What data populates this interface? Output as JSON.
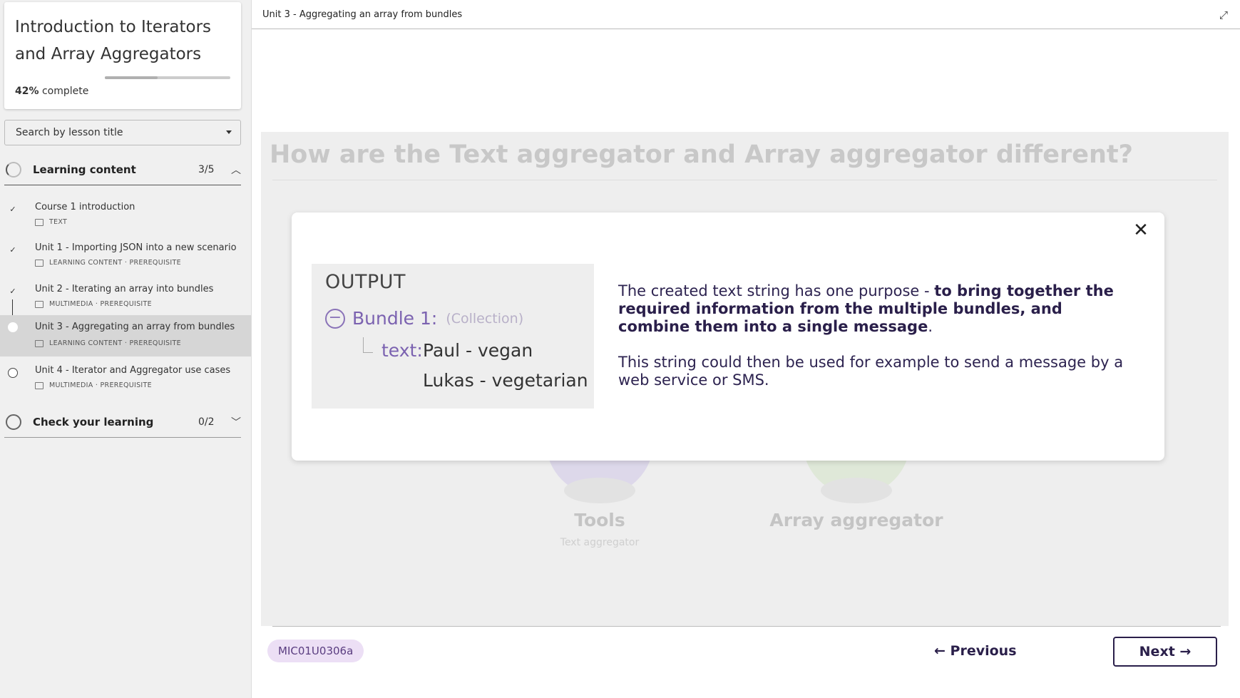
{
  "sidebar": {
    "course_title": "Introduction to Iterators and Array Aggregators",
    "progress": {
      "percent_label": "42%",
      "suffix": " complete",
      "value": 0.42
    },
    "search": {
      "placeholder": "Search by lesson title"
    },
    "sections": [
      {
        "label": "Learning content",
        "count": "3/5",
        "expanded": true
      },
      {
        "label": "Check your learning",
        "count": "0/2",
        "expanded": false
      }
    ],
    "lessons": [
      {
        "title": "Course 1 introduction",
        "meta": "TEXT",
        "status": "done"
      },
      {
        "title": "Unit 1 - Importing JSON into a new scenario",
        "meta": "LEARNING CONTENT · PREREQUISITE",
        "status": "done"
      },
      {
        "title": "Unit 2 - Iterating an array into bundles",
        "meta": "MULTIMEDIA · PREREQUISITE",
        "status": "done"
      },
      {
        "title": "Unit 3 - Aggregating an array from bundles",
        "meta": "LEARNING CONTENT · PREREQUISITE",
        "status": "current"
      },
      {
        "title": "Unit 4 - Iterator and Aggregator use cases",
        "meta": "MULTIMEDIA · PREREQUISITE",
        "status": "open"
      }
    ]
  },
  "topbar": {
    "title": "Unit 3 - Aggregating an array from bundles"
  },
  "stage": {
    "heading": "How are the Text aggregator and Array aggregator different?",
    "tools": [
      {
        "label": "Tools",
        "sub": "Text aggregator"
      },
      {
        "label": "Array aggregator"
      }
    ]
  },
  "modal": {
    "output": {
      "title": "OUTPUT",
      "bundle_label": "Bundle 1:",
      "bundle_type": "(Collection)",
      "key": "text:",
      "value_line1": "Paul - vegan",
      "value_line2": "Lukas - vegetarian"
    },
    "text": {
      "p1_plain": "The created text string has one purpose - ",
      "p1_bold": "to bring together the required information from the multiple bundles, and combine them into a single message",
      "p1_end": ".",
      "p2": "This string could then be used for example to send a message by a web service or SMS."
    }
  },
  "footer": {
    "tag": "MIC01U0306a",
    "previous_label": "← Previous",
    "next_label": "Next →"
  },
  "colors": {
    "accent": "#2a1f4a",
    "purple": "#7b62b0",
    "tag_bg": "#ecdff5"
  },
  "icons": [
    "check-icon",
    "caret-down-icon",
    "chevron-up-icon",
    "chevron-down-icon",
    "expand-icon",
    "close-icon",
    "document-icon",
    "media-icon",
    "minus-circle-icon"
  ]
}
